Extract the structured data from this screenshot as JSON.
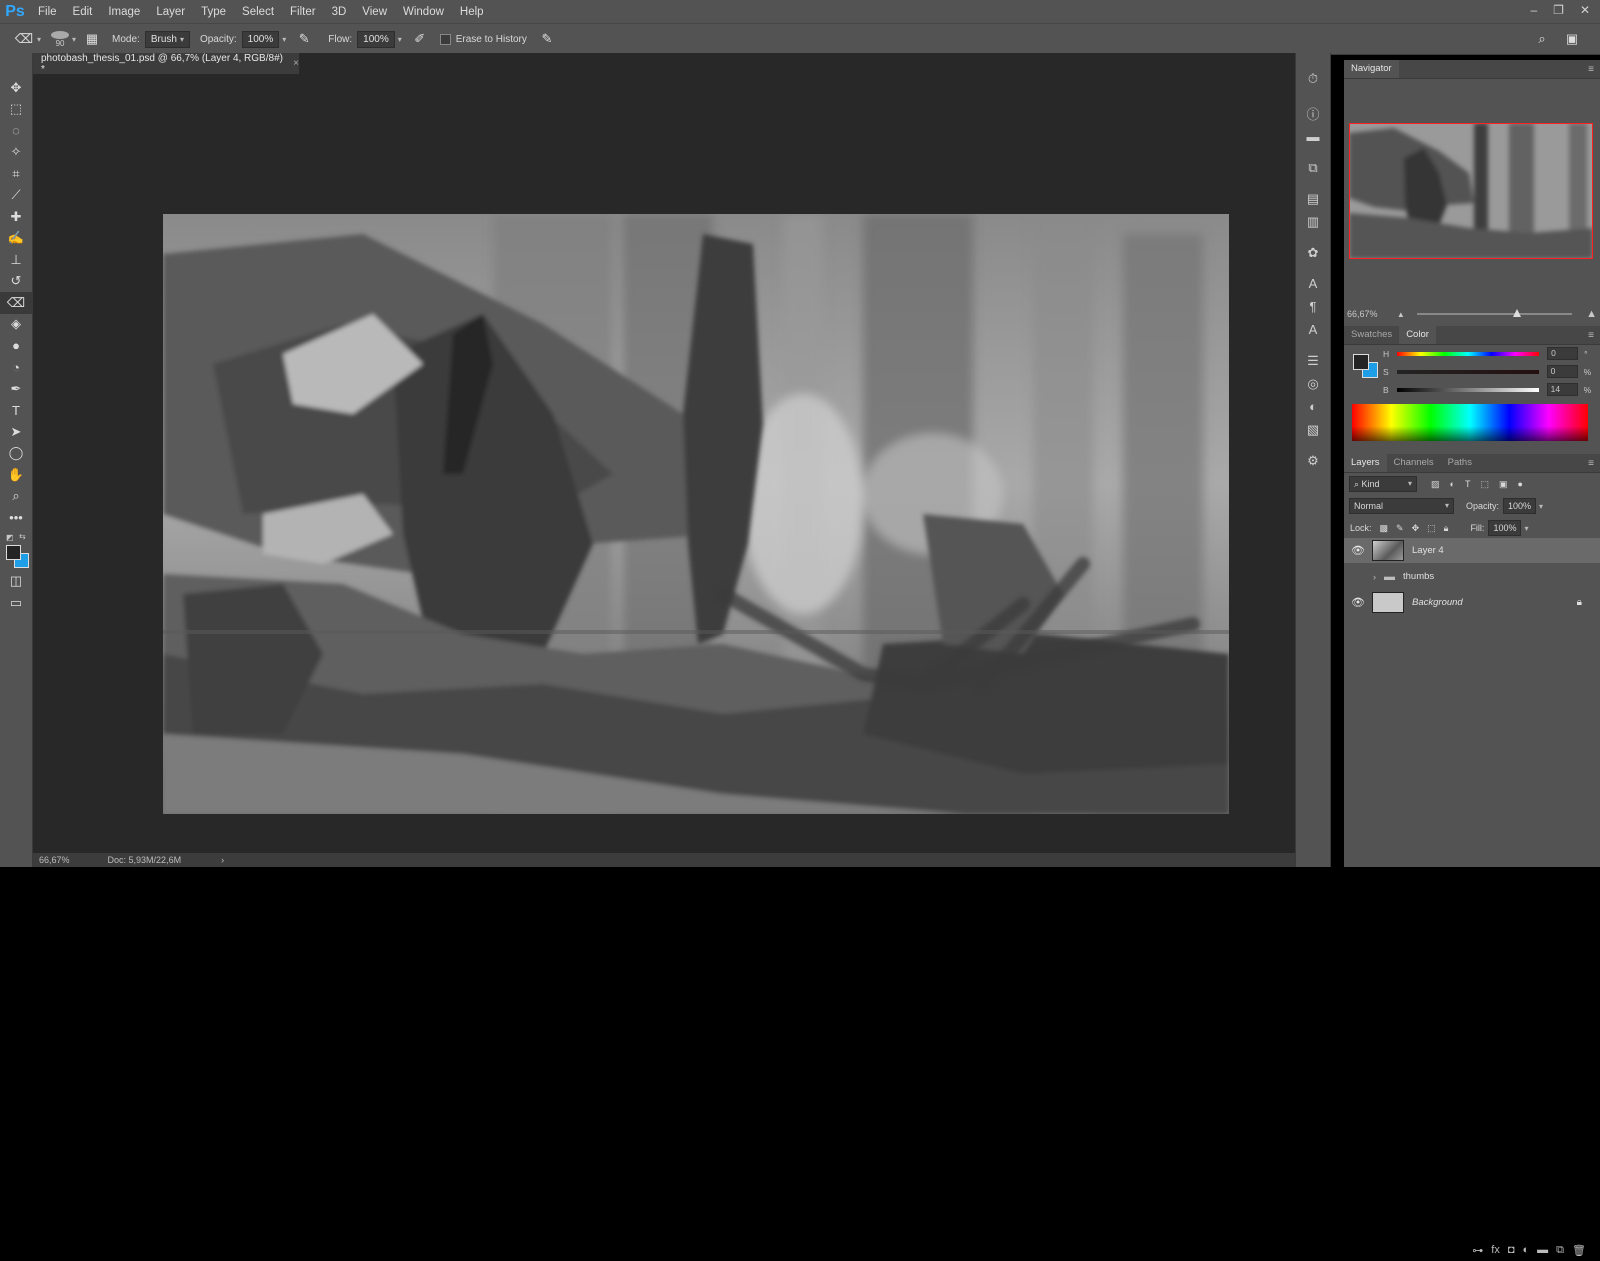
{
  "app": {
    "logo": "Ps",
    "menu": [
      "File",
      "Edit",
      "Image",
      "Layer",
      "Type",
      "Select",
      "Filter",
      "3D",
      "View",
      "Window",
      "Help"
    ],
    "window_controls": [
      "minimize",
      "restore",
      "close"
    ]
  },
  "options_bar": {
    "tool_icon": "eraser-icon",
    "brush_size": "90",
    "mode_label": "Mode:",
    "mode_value": "Brush",
    "opacity_label": "Opacity:",
    "opacity_value": "100%",
    "flow_label": "Flow:",
    "flow_value": "100%",
    "erase_to_history_label": "Erase to History"
  },
  "tools": [
    "move-tool",
    "marquee-tool",
    "lasso-tool",
    "magic-wand-tool",
    "crop-tool",
    "eyedropper-tool",
    "healing-brush-tool",
    "brush-tool",
    "clone-stamp-tool",
    "history-brush-tool",
    "eraser-tool",
    "paint-bucket-tool",
    "blur-tool",
    "dodge-tool",
    "pen-tool",
    "type-tool",
    "path-selection-tool",
    "ellipse-tool",
    "hand-tool",
    "zoom-tool",
    "more-tools"
  ],
  "document": {
    "tab_title": "photobash_thesis_01.psd @ 66,7% (Layer 4, RGB/8#) *",
    "close_label": "×"
  },
  "status": {
    "zoom": "66,67%",
    "doc_info": "Doc: 5,93M/22,6M",
    "arrow": "›"
  },
  "navigator": {
    "title": "Navigator",
    "zoom": "66,67%"
  },
  "color_panel": {
    "tabs": [
      "Swatches",
      "Color"
    ],
    "active_tab": "Color",
    "h_label": "H",
    "h_value": "0",
    "h_unit": "°",
    "s_label": "S",
    "s_value": "0",
    "s_unit": "%",
    "b_label": "B",
    "b_value": "14",
    "b_unit": "%",
    "foreground_color": "#242424",
    "background_color": "#1e9ee6"
  },
  "layers_panel": {
    "tabs": [
      "Layers",
      "Channels",
      "Paths"
    ],
    "active_tab": "Layers",
    "filter_kind": "Kind",
    "blend_mode": "Normal",
    "opacity_label": "Opacity:",
    "opacity_value": "100%",
    "lock_label": "Lock:",
    "fill_label": "Fill:",
    "fill_value": "100%",
    "layers": [
      {
        "name": "Layer 4",
        "visible": true,
        "selected": true
      },
      {
        "name": "thumbs",
        "visible": false,
        "group": true
      },
      {
        "name": "Background",
        "visible": true,
        "locked": true
      }
    ]
  }
}
